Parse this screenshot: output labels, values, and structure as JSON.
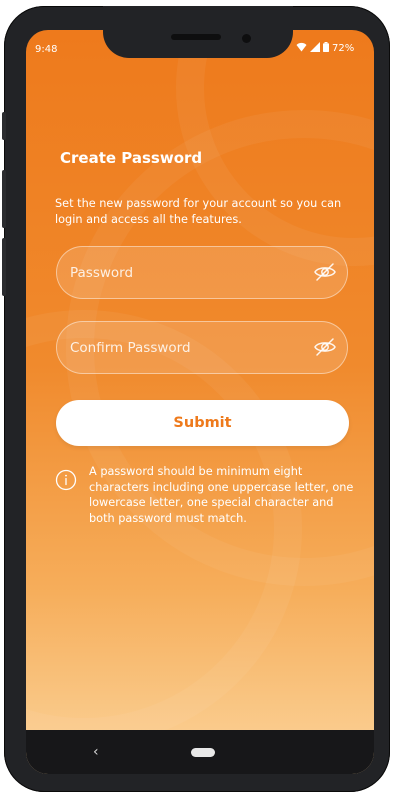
{
  "status_bar": {
    "time": "9:48",
    "battery": "72%"
  },
  "page": {
    "title": "Create Password",
    "description": "Set the new password for your account so you can login and access all the features."
  },
  "form": {
    "password_placeholder": "Password",
    "confirm_placeholder": "Confirm Password",
    "submit_label": "Submit"
  },
  "info": {
    "text": "A password should be minimum eight characters including one uppercase letter, one lowercase letter, one special character and both password must match."
  },
  "nav": {
    "back_glyph": "‹"
  },
  "colors": {
    "accent": "#ee7a1c",
    "background_top": "#ee7a1c",
    "background_bottom": "#fbd49b"
  },
  "icons": {
    "password_toggle": "eye-off-icon",
    "confirm_toggle": "eye-off-icon",
    "info": "info-icon",
    "wifi": "wifi-icon",
    "signal": "signal-icon",
    "battery": "battery-icon"
  }
}
